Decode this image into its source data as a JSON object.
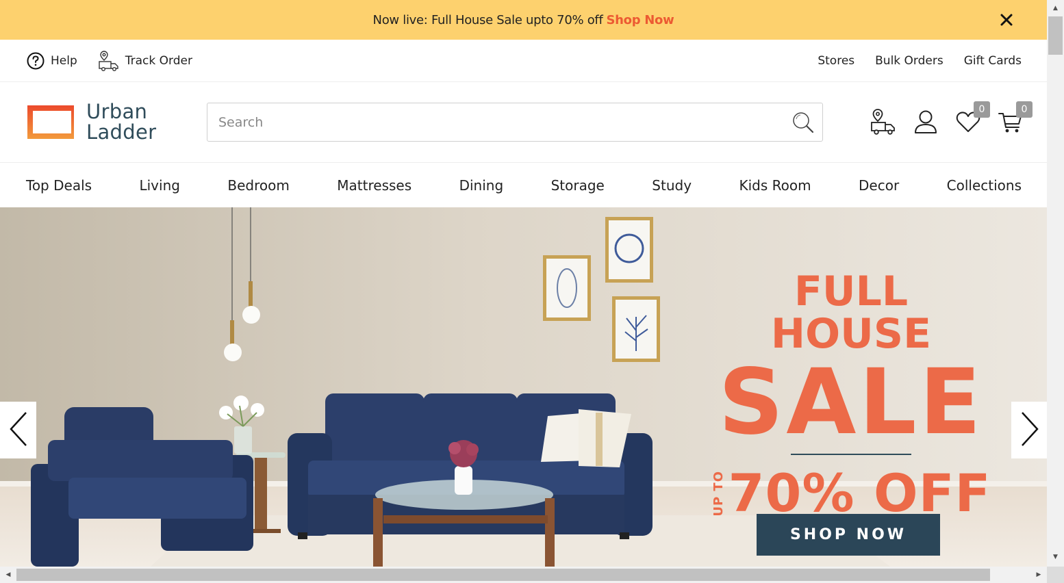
{
  "announcement": {
    "text": "Now live: Full House Sale upto 70% off",
    "cta": "Shop Now",
    "close_icon": "close-icon"
  },
  "utility": {
    "help": "Help",
    "track_order": "Track Order",
    "stores": "Stores",
    "bulk_orders": "Bulk Orders",
    "gift_cards": "Gift Cards"
  },
  "brand": {
    "line1": "Urban",
    "line2": "Ladder",
    "colors": {
      "text": "#2f4c5a",
      "mark_top": "#ec5a32",
      "mark_bottom": "#f08a3a"
    }
  },
  "search": {
    "placeholder": "Search",
    "value": "",
    "icon": "search-icon"
  },
  "header_icons": {
    "store_locator": "store-locator-icon",
    "account": "user-icon",
    "wishlist": "heart-icon",
    "wishlist_count": "0",
    "cart": "cart-icon",
    "cart_count": "0"
  },
  "nav": {
    "items": [
      "Top Deals",
      "Living",
      "Bedroom",
      "Mattresses",
      "Dining",
      "Storage",
      "Study",
      "Kids Room",
      "Decor",
      "Collections"
    ]
  },
  "hero": {
    "line1": "FULL HOUSE",
    "line2": "SALE",
    "upto": "UP TO",
    "discount": "70% OFF",
    "cta": "SHOP NOW",
    "accent_color": "#ec6a48",
    "button_color": "#2b4658",
    "prev_icon": "chevron-left-icon",
    "next_icon": "chevron-right-icon"
  },
  "colors": {
    "announcement_bg": "#fdd16e",
    "announcement_cta": "#ec5a32"
  }
}
